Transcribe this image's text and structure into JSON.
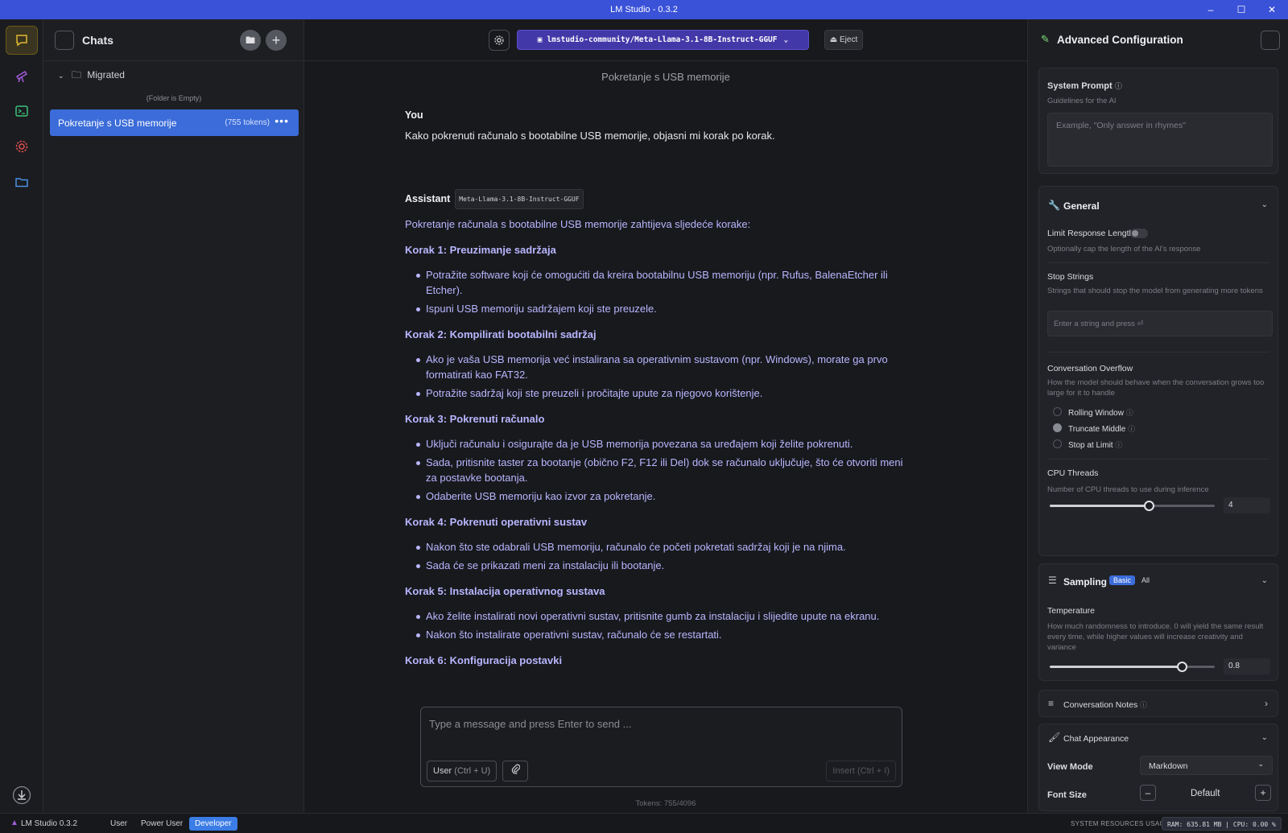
{
  "window": {
    "title": "LM Studio - 0.3.2"
  },
  "sidebar": {
    "title": "Chats",
    "folder": "Migrated",
    "folder_empty": "(Folder is Empty)",
    "chat": {
      "name": "Pokretanje s USB memorije",
      "tokens": "(755 tokens)"
    }
  },
  "main": {
    "model": "lmstudio-community/Meta-Llama-3.1-8B-Instruct-GGUF",
    "eject": "Eject",
    "chat_title": "Pokretanje s USB memorije",
    "user_role": "You",
    "user_message": "Kako pokrenuti računalo s bootabilne USB memorije, objasni mi korak po korak.",
    "assistant_role": "Assistant",
    "assistant_model": "Meta-Llama-3.1-8B-Instruct-GGUF",
    "intro": "Pokretanje računala s bootabilne USB memorije zahtijeva sljedeće korake:",
    "steps": [
      {
        "title": "Korak 1: Preuzimanje sadržaja",
        "items": [
          "Potražite software koji će omogućiti da kreira bootabilnu USB memoriju (npr. Rufus, BalenaEtcher ili Etcher).",
          "Ispuni USB memoriju sadržajem koji ste preuzele."
        ]
      },
      {
        "title": "Korak 2: Kompilirati bootabilni sadržaj",
        "items": [
          "Ako je vaša USB memorija već instalirana sa operativnim sustavom (npr. Windows), morate ga prvo formatirati kao FAT32.",
          "Potražite sadržaj koji ste preuzeli i pročitajte upute za njegovo korištenje."
        ]
      },
      {
        "title": "Korak 3: Pokrenuti računalo",
        "items": [
          "Uključi računalu i osigurajte da je USB memorija povezana sa uređajem koji želite pokrenuti.",
          "Sada, pritisnite taster za bootanje (obično F2, F12 ili Del) dok se računalo uključuje, što će otvoriti meni za postavke bootanja.",
          "Odaberite USB memoriju kao izvor za pokretanje."
        ]
      },
      {
        "title": "Korak 4: Pokrenuti operativni sustav",
        "items": [
          "Nakon što ste odabrali USB memoriju, računalo će početi pokretati sadržaj koji je na njima.",
          "Sada će se prikazati meni za instalaciju ili bootanje."
        ]
      },
      {
        "title": "Korak 5: Instalacija operativnog sustava",
        "items": [
          "Ako želite instalirati novi operativni sustav, pritisnite gumb za instalaciju i slijedite upute na ekranu.",
          "Nakon što instalirate operativni sustav, računalo će se restartati."
        ]
      },
      {
        "title": "Korak 6: Konfiguracija postavki",
        "items": []
      }
    ],
    "composer_placeholder": "Type a message and press Enter to send ...",
    "role_btn": "User",
    "role_hint": "(Ctrl + U)",
    "insert_btn": "Insert (Ctrl + I)",
    "tokens": "Tokens: 755/4096"
  },
  "config": {
    "title": "Advanced Configuration",
    "system_prompt": {
      "label": "System Prompt",
      "sub": "Guidelines for the AI",
      "placeholder": "Example, \"Only answer in rhymes\""
    },
    "general": {
      "title": "General",
      "limit_label": "Limit Response Length",
      "limit_sub": "Optionally cap the length of the AI's response",
      "stop_label": "Stop Strings",
      "stop_sub": "Strings that should stop the model from generating more tokens",
      "stop_placeholder": "Enter a string and press ⏎",
      "overflow_label": "Conversation Overflow",
      "overflow_sub": "How the model should behave when the conversation grows too large for it to handle",
      "overflow_options": [
        "Rolling Window",
        "Truncate Middle",
        "Stop at Limit"
      ],
      "overflow_selected": 1,
      "cpu_label": "CPU Threads",
      "cpu_sub": "Number of CPU threads to use during inference",
      "cpu_value": "4",
      "cpu_fraction": 0.6
    },
    "sampling": {
      "title": "Sampling",
      "tab_basic": "Basic",
      "tab_all": "All",
      "temp_label": "Temperature",
      "temp_sub": "How much randomness to introduce. 0 will yield the same result every time, while higher values will increase creativity and variance",
      "temp_value": "0.8",
      "temp_fraction": 0.8
    },
    "notes": {
      "title": "Conversation Notes"
    },
    "appearance": {
      "title": "Chat Appearance",
      "view_mode_label": "View Mode",
      "view_mode_value": "Markdown",
      "font_size_label": "Font Size",
      "font_size_value": "Default"
    }
  },
  "statusbar": {
    "version": "LM Studio 0.3.2",
    "modes": [
      "User",
      "Power User",
      "Developer"
    ],
    "active_mode": 2,
    "resources_label": "SYSTEM RESOURCES USAGE:",
    "resources": "RAM: 635.81 MB | CPU: 0.00 %"
  },
  "colors": {
    "accent": "#3b6cd9",
    "model_button": "#4338a8",
    "assistant_text": "#b9b6ff",
    "title_bar": "#3a52d8"
  }
}
